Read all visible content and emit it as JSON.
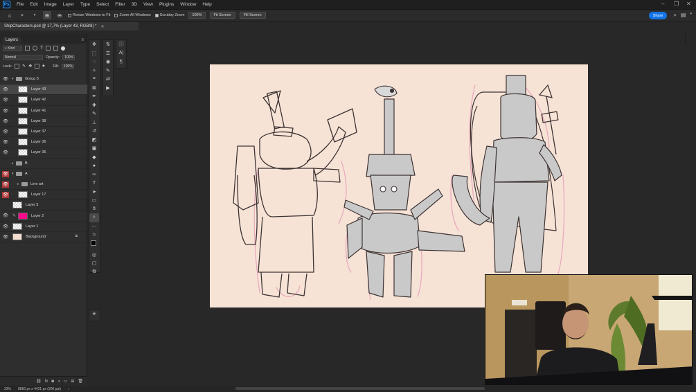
{
  "menubar": {
    "app_icon": "Ps",
    "items": [
      "File",
      "Edit",
      "Image",
      "Layer",
      "Type",
      "Select",
      "Filter",
      "3D",
      "View",
      "Plugins",
      "Window",
      "Help"
    ]
  },
  "optionsbar": {
    "resize_windows": "Resize Windows to Fit",
    "zoom_all": "Zoom All Windows",
    "scrubby_zoom": "Scrubby Zoom",
    "zoom_value": "100%",
    "fit_screen": "Fit Screen",
    "fill_screen": "Fill Screen",
    "share": "Share"
  },
  "document": {
    "tab_title": "ShipCharacters.psd @ 17,7% (Layer 43, RGB/8) *"
  },
  "layers_panel": {
    "tab_label": "Layers",
    "filter_kind": "Kind",
    "blend_mode": "Normal",
    "opacity_label": "Opacity:",
    "opacity_value": "100%",
    "lock_label": "Lock:",
    "fill_label": "Fill:",
    "fill_value": "100%",
    "layers": [
      {
        "name": "Group 5",
        "type": "group",
        "eye": true,
        "red": false
      },
      {
        "name": "Layer 43",
        "type": "layer",
        "eye": true,
        "red": false,
        "selected": true
      },
      {
        "name": "Layer 42",
        "type": "layer",
        "eye": true,
        "red": false
      },
      {
        "name": "Layer 41",
        "type": "layer",
        "eye": true,
        "red": false
      },
      {
        "name": "Layer 38",
        "type": "layer",
        "eye": true,
        "red": false
      },
      {
        "name": "Layer 37",
        "type": "layer",
        "eye": true,
        "red": false
      },
      {
        "name": "Layer 36",
        "type": "layer",
        "eye": true,
        "red": false
      },
      {
        "name": "Layer 35",
        "type": "layer",
        "eye": true,
        "red": false
      },
      {
        "name": "B",
        "type": "group",
        "eye": false,
        "red": false
      },
      {
        "name": "A",
        "type": "group",
        "eye": true,
        "red": true
      },
      {
        "name": "Line art",
        "type": "group",
        "eye": true,
        "red": true
      },
      {
        "name": "Layer 17",
        "type": "layer",
        "eye": true,
        "red": true
      },
      {
        "name": "Layer 3",
        "type": "layer",
        "eye": false,
        "red": false
      },
      {
        "name": "Layer 2",
        "type": "pink",
        "eye": true,
        "red": false
      },
      {
        "name": "Layer 1",
        "type": "layer",
        "eye": true,
        "red": false
      },
      {
        "name": "Background",
        "type": "bg",
        "eye": true,
        "red": false
      }
    ]
  },
  "statusbar": {
    "zoom": "23%",
    "doc_size": "8860 px x 4421 px (300 ppi)"
  }
}
